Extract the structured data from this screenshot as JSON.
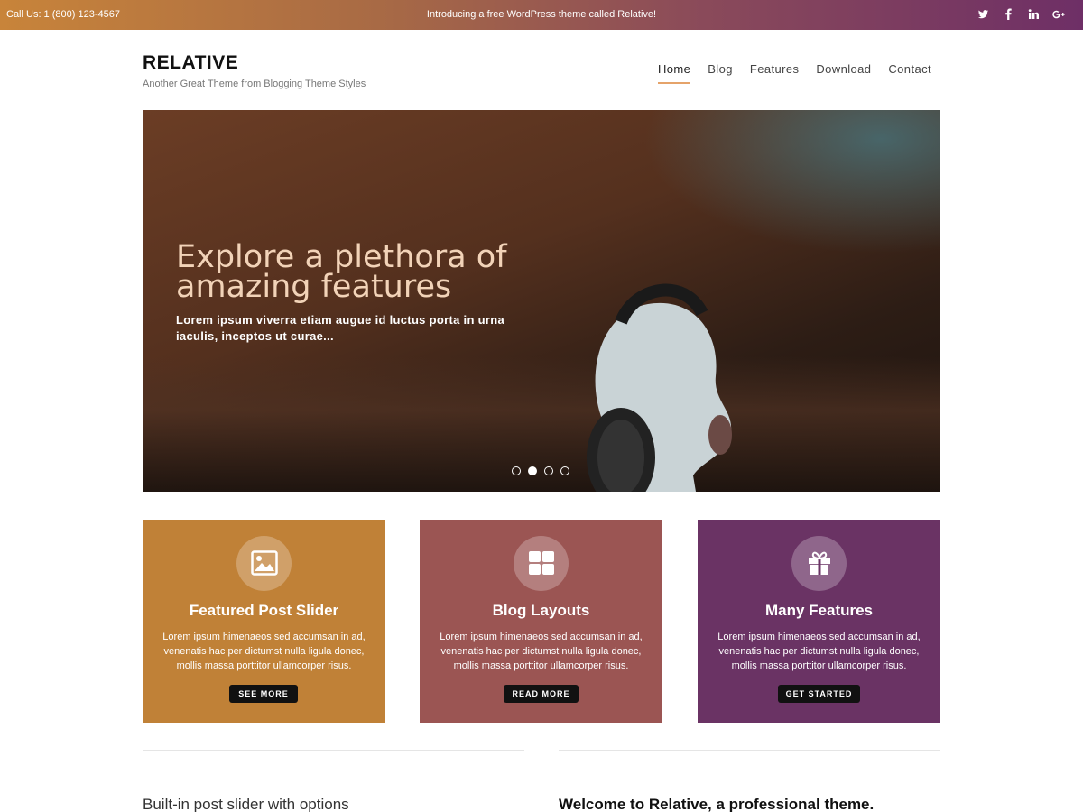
{
  "topbar": {
    "call": "Call Us: 1 (800) 123-4567",
    "promo": "Introducing a free WordPress theme called Relative!",
    "social": [
      "twitter-icon",
      "facebook-icon",
      "linkedin-icon",
      "google-plus-icon"
    ]
  },
  "brand": {
    "name": "RELATIVE",
    "tagline": "Another Great Theme from Blogging Theme Styles"
  },
  "nav": [
    "Home",
    "Blog",
    "Features",
    "Download",
    "Contact"
  ],
  "hero": {
    "title": "Explore a plethora of amazing features",
    "subtitle": "Lorem ipsum viverra etiam augue id luctus porta in urna iaculis, inceptos ut curae...",
    "slides": 4,
    "active_slide": 2
  },
  "cards": [
    {
      "title": "Featured Post Slider",
      "body": "Lorem ipsum himenaeos sed accumsan in ad, venenatis hac per dictumst nulla ligula donec, mollis massa porttitor ullamcorper risus.",
      "button": "SEE MORE",
      "icon": "image-icon",
      "color": "#c08137"
    },
    {
      "title": "Blog Layouts",
      "body": "Lorem ipsum himenaeos sed accumsan in ad, venenatis hac per dictumst nulla ligula donec, mollis massa porttitor ullamcorper risus.",
      "button": "READ MORE",
      "icon": "grid-icon",
      "color": "#9b5553"
    },
    {
      "title": "Many Features",
      "body": "Lorem ipsum himenaeos sed accumsan in ad, venenatis hac per dictumst nulla ligula donec, mollis massa porttitor ullamcorper risus.",
      "button": "GET STARTED",
      "icon": "gift-icon",
      "color": "#6a3364"
    }
  ],
  "bottom": {
    "left_heading": "Built-in post slider with options",
    "right_heading": "Welcome to Relative, a professional theme."
  }
}
